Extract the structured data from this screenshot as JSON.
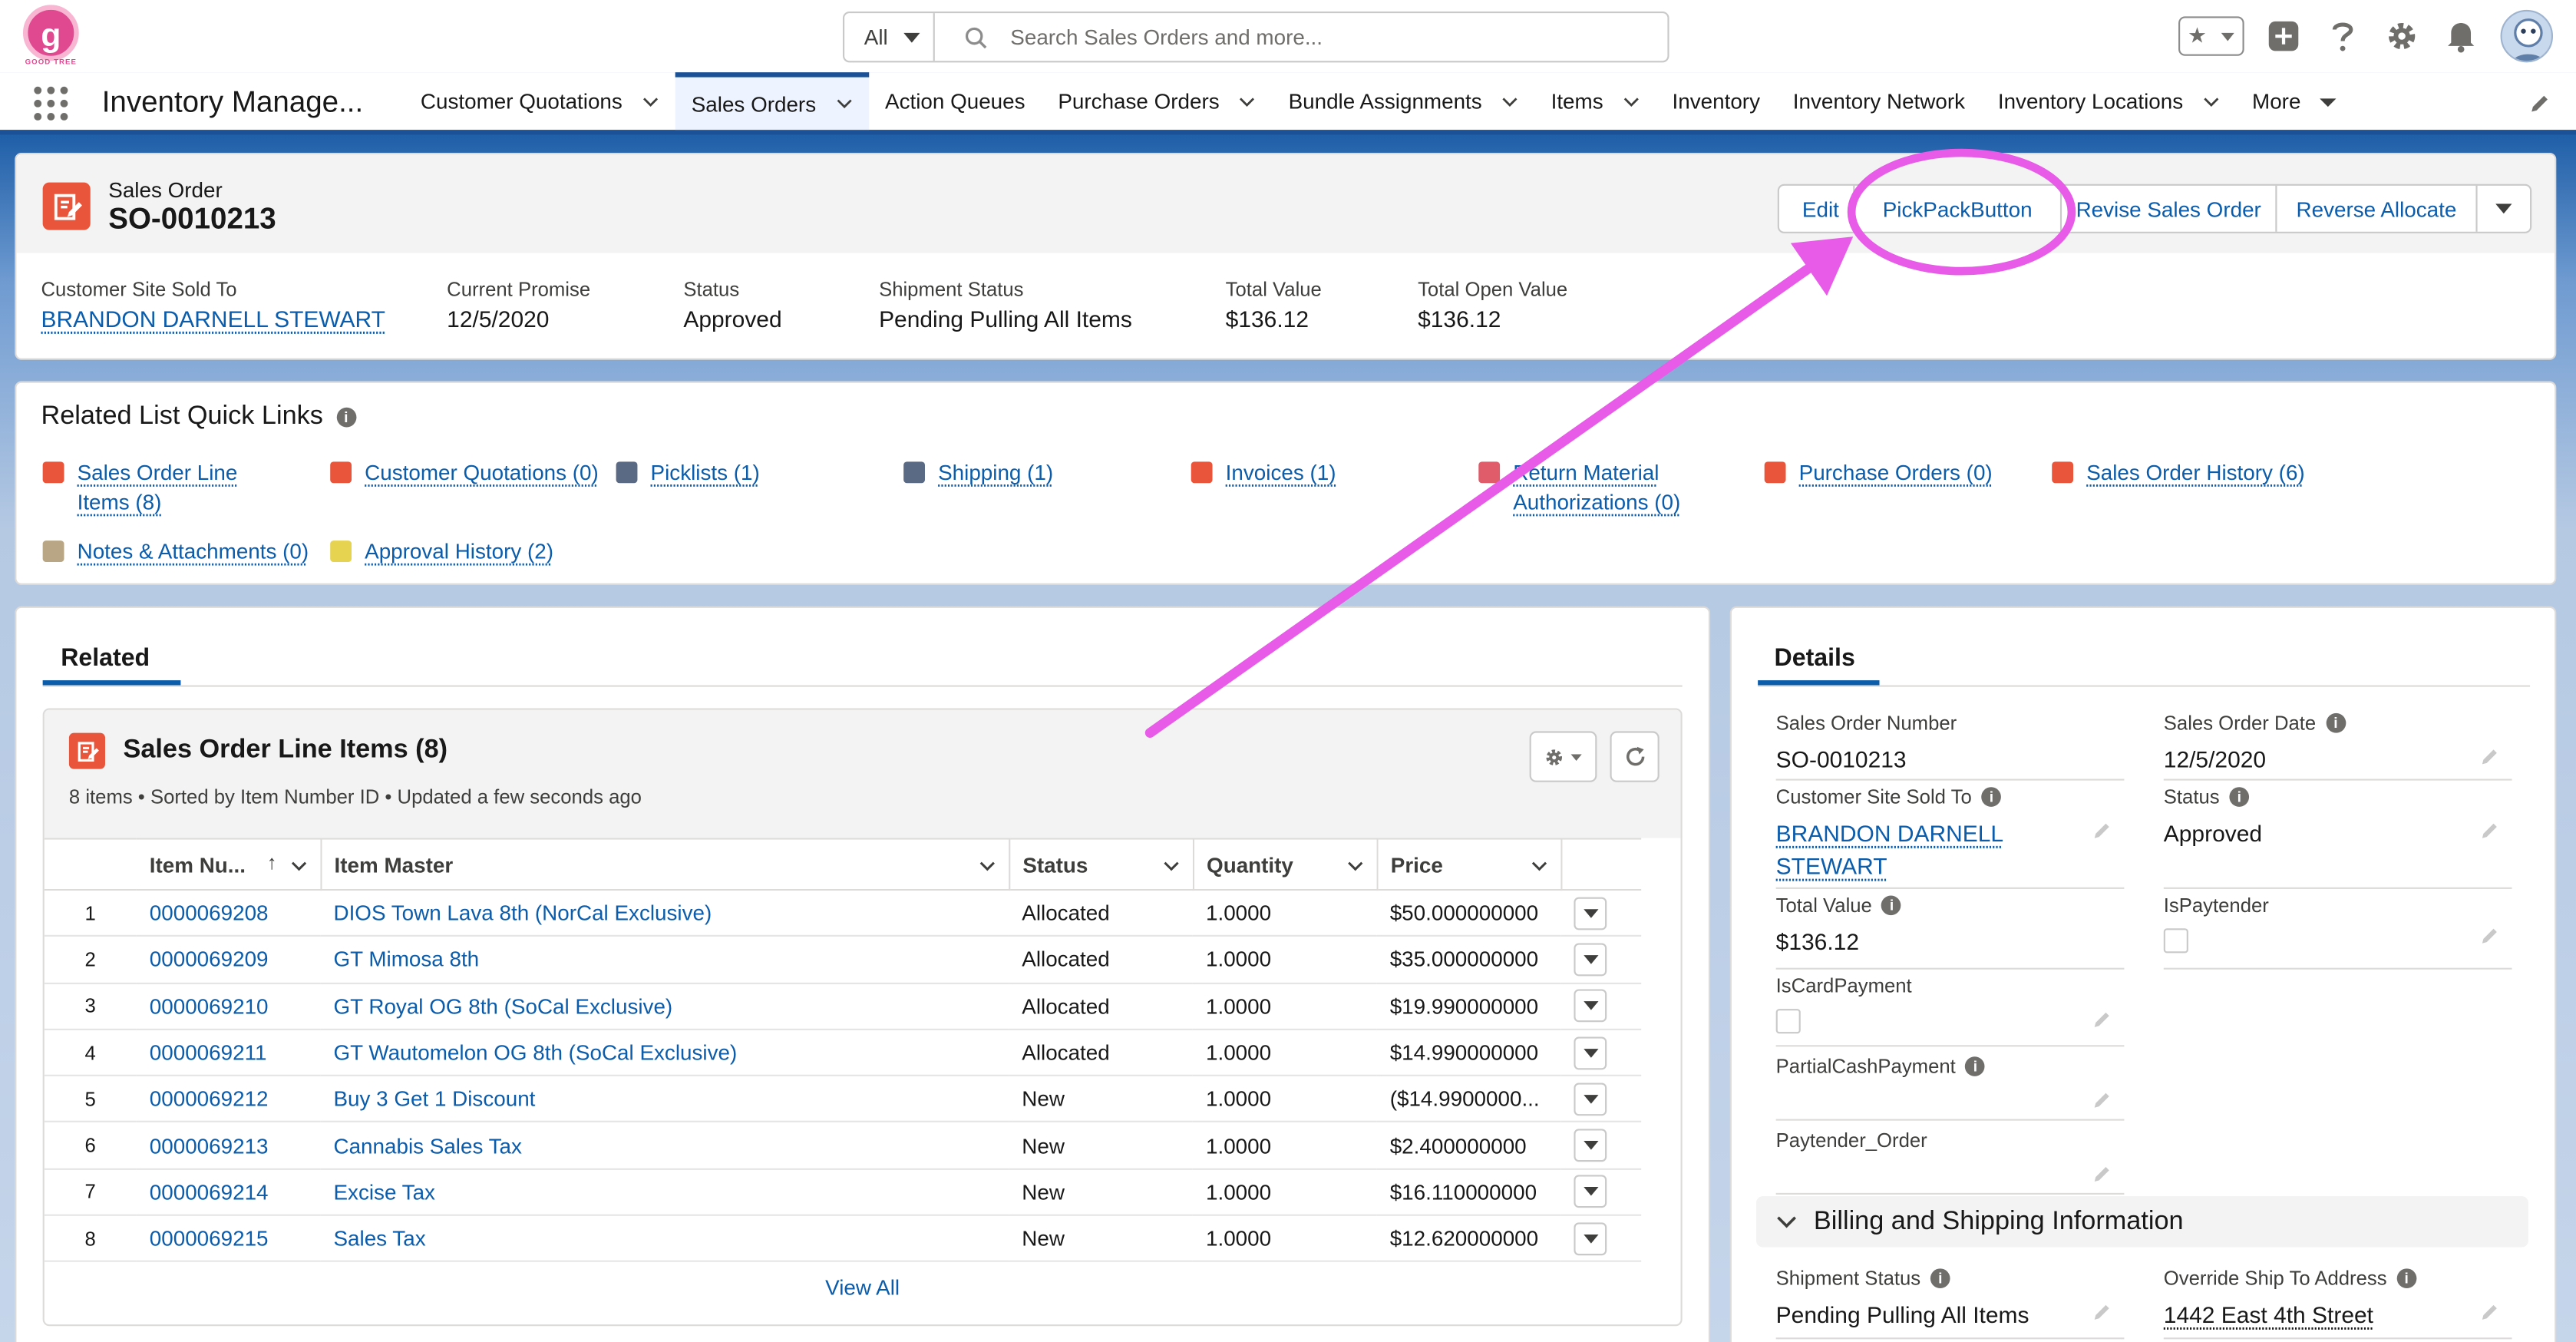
{
  "brand": {
    "logo_letter": "g",
    "logo_text": "GOOD TREE",
    "accent": "#e0488f"
  },
  "search": {
    "scope": "All",
    "placeholder": "Search Sales Orders and more..."
  },
  "app": {
    "name": "Inventory Manage..."
  },
  "nav": {
    "items": [
      {
        "label": "Customer Quotations",
        "dropdown": true,
        "active": false
      },
      {
        "label": "Sales Orders",
        "dropdown": true,
        "active": true
      },
      {
        "label": "Action Queues",
        "dropdown": false,
        "active": false
      },
      {
        "label": "Purchase Orders",
        "dropdown": true,
        "active": false
      },
      {
        "label": "Bundle Assignments",
        "dropdown": true,
        "active": false
      },
      {
        "label": "Items",
        "dropdown": true,
        "active": false
      },
      {
        "label": "Inventory",
        "dropdown": false,
        "active": false
      },
      {
        "label": "Inventory Network",
        "dropdown": false,
        "active": false
      },
      {
        "label": "Inventory Locations",
        "dropdown": true,
        "active": false
      },
      {
        "label": "More",
        "dropdown": true,
        "active": false
      }
    ]
  },
  "record": {
    "type": "Sales Order",
    "name": "SO-0010213",
    "actions": {
      "edit": "Edit",
      "pickpack": "PickPackButton",
      "revise": "Revise Sales Order",
      "reverse": "Reverse Allocate"
    },
    "highlights": {
      "sold_to_label": "Customer Site Sold To",
      "sold_to_value": "BRANDON DARNELL STEWART",
      "promise_label": "Current Promise",
      "promise_value": "12/5/2020",
      "status_label": "Status",
      "status_value": "Approved",
      "shipment_label": "Shipment Status",
      "shipment_value": "Pending Pulling All Items",
      "total_label": "Total Value",
      "total_value": "$136.12",
      "open_label": "Total Open Value",
      "open_value": "$136.12"
    }
  },
  "quick_links": {
    "title": "Related List Quick Links",
    "links": {
      "sol_1": "Sales Order Line",
      "sol_2": "Items (8)",
      "cq": "Customer Quotations (0)",
      "picklists": "Picklists (1)",
      "shipping": "Shipping (1)",
      "invoices": "Invoices (1)",
      "rma_1": "Return Material",
      "rma_2": "Authorizations (0)",
      "po": "Purchase Orders (0)",
      "soh": "Sales Order History (6)",
      "notes": "Notes & Attachments (0)",
      "approval": "Approval History (2)"
    }
  },
  "related": {
    "tab": "Related",
    "list_title": "Sales Order Line Items (8)",
    "list_sub": "8 items • Sorted by Item Number ID • Updated a few seconds ago",
    "columns": {
      "item_number": "Item Nu...",
      "sort_arrow": "↑",
      "item_master": "Item Master",
      "status": "Status",
      "quantity": "Quantity",
      "price": "Price"
    },
    "rows": [
      {
        "n": "1",
        "item": "0000069208",
        "master": "DIOS Town Lava 8th (NorCal Exclusive)",
        "status": "Allocated",
        "qty": "1.0000",
        "price": "$50.000000000"
      },
      {
        "n": "2",
        "item": "0000069209",
        "master": "GT Mimosa 8th",
        "status": "Allocated",
        "qty": "1.0000",
        "price": "$35.000000000"
      },
      {
        "n": "3",
        "item": "0000069210",
        "master": "GT Royal OG 8th (SoCal Exclusive)",
        "status": "Allocated",
        "qty": "1.0000",
        "price": "$19.990000000"
      },
      {
        "n": "4",
        "item": "0000069211",
        "master": "GT Wautomelon OG 8th (SoCal Exclusive)",
        "status": "Allocated",
        "qty": "1.0000",
        "price": "$14.990000000"
      },
      {
        "n": "5",
        "item": "0000069212",
        "master": "Buy 3 Get 1 Discount",
        "status": "New",
        "qty": "1.0000",
        "price": "($14.9900000..."
      },
      {
        "n": "6",
        "item": "0000069213",
        "master": "Cannabis Sales Tax",
        "status": "New",
        "qty": "1.0000",
        "price": "$2.400000000"
      },
      {
        "n": "7",
        "item": "0000069214",
        "master": "Excise Tax",
        "status": "New",
        "qty": "1.0000",
        "price": "$16.110000000"
      },
      {
        "n": "8",
        "item": "0000069215",
        "master": "Sales Tax",
        "status": "New",
        "qty": "1.0000",
        "price": "$12.620000000"
      }
    ],
    "view_all": "View All"
  },
  "details": {
    "tab": "Details",
    "fields": {
      "so_number_label": "Sales Order Number",
      "so_number_value": "SO-0010213",
      "so_date_label": "Sales Order Date",
      "so_date_value": "12/5/2020",
      "sold_to_label": "Customer Site Sold To",
      "sold_to_value_1": "BRANDON DARNELL",
      "sold_to_value_2": "STEWART",
      "status_label": "Status",
      "status_value": "Approved",
      "total_label": "Total Value",
      "total_value": "$136.12",
      "ispaytender_label": "IsPaytender",
      "iscard_label": "IsCardPayment",
      "partial_label": "PartialCashPayment",
      "paytender_order_label": "Paytender_Order",
      "section_title": "Billing and Shipping Information",
      "ship_status_label": "Shipment Status",
      "ship_status_value": "Pending Pulling All Items",
      "override_label": "Override Ship To Address",
      "override_value": "1442 East 4th Street"
    }
  },
  "annotation": {
    "color": "#e85ae8"
  }
}
